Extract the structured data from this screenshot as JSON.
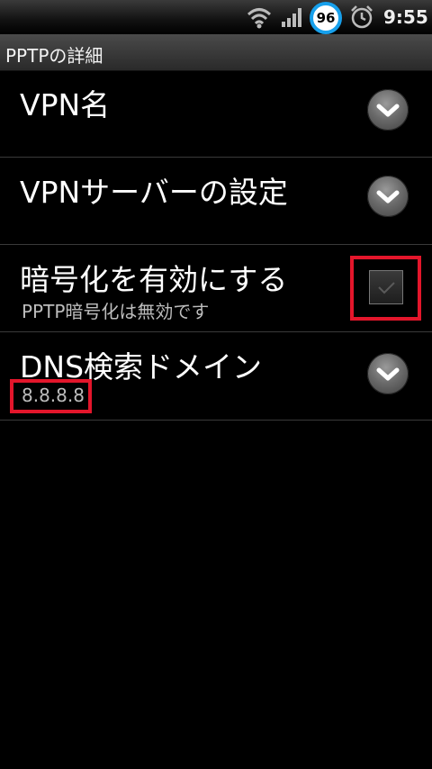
{
  "status_bar": {
    "battery_level": "96",
    "time": "9:55",
    "icons": [
      "wifi-icon",
      "signal-icon",
      "battery-icon",
      "alarm-icon"
    ],
    "battery_ring_color": "#17a0ec"
  },
  "header": {
    "title": "PPTPの詳細"
  },
  "settings": [
    {
      "title": "VPN名",
      "summary": "",
      "control": "chevron-down-icon"
    },
    {
      "title": "VPNサーバーの設定",
      "summary": "",
      "control": "chevron-down-icon"
    },
    {
      "title": "暗号化を有効にする",
      "summary": "PPTP暗号化は無効です",
      "control": "checkbox",
      "checked": false
    },
    {
      "title": "DNS検索ドメイン",
      "summary": "8.8.8.8",
      "control": "chevron-down-icon"
    }
  ],
  "highlight_color": "#e3162b"
}
